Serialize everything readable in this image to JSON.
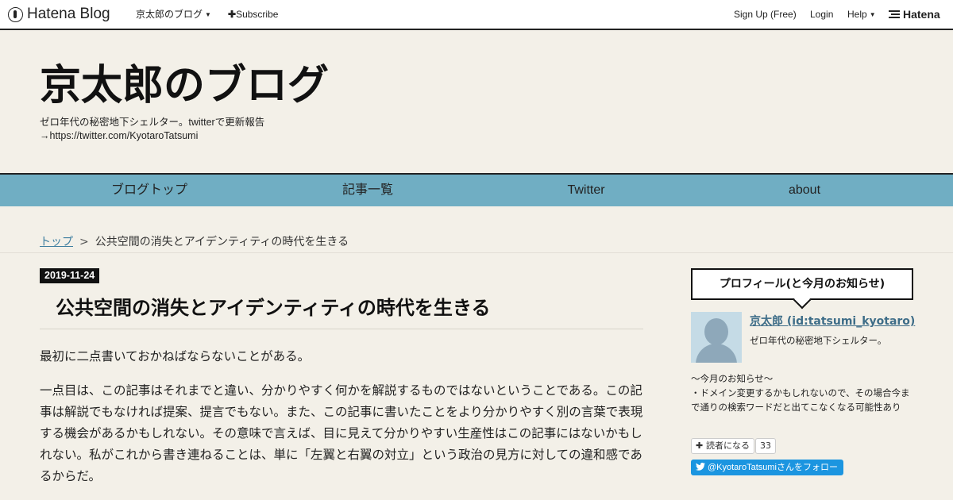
{
  "topbar": {
    "logo": "Hatena Blog",
    "blog_menu": "京太郎のブログ",
    "subscribe": "Subscribe",
    "signup": "Sign Up (Free)",
    "login": "Login",
    "help": "Help",
    "brand": "Hatena"
  },
  "header": {
    "title": "京太郎のブログ",
    "description_line1": "ゼロ年代の秘密地下シェルター。twitterで更新報告",
    "description_line2": "→https://twitter.com/KyotaroTatsumi"
  },
  "nav": {
    "items": [
      {
        "label": "ブログトップ"
      },
      {
        "label": "記事一覧"
      },
      {
        "label": "Twitter"
      },
      {
        "label": "about"
      }
    ]
  },
  "breadcrumb": {
    "home": "トップ",
    "separator": ">",
    "current": "公共空間の消失とアイデンティティの時代を生きる"
  },
  "article": {
    "date": "2019-11-24",
    "title": "公共空間の消失とアイデンティティの時代を生きる",
    "paragraphs": [
      "最初に二点書いておかねばならないことがある。",
      "一点目は、この記事はそれまでと違い、分かりやすく何かを解説するものではないということである。この記事は解説でもなければ提案、提言でもない。また、この記事に書いたことをより分かりやすく別の言葉で表現する機会があるかもしれない。その意味で言えば、目に見えて分かりやすい生産性はこの記事にはないかもしれない。私がこれから書き連ねることは、単に「左翼と右翼の対立」という政治の見方に対しての違和感であるからだ。"
    ]
  },
  "sidebar": {
    "profile_heading": "プロフィール(と今月のお知らせ)",
    "profile_name": "京太郎 (id:tatsumi_kyotaro)",
    "profile_desc": "ゼロ年代の秘密地下シェルター。",
    "notice_title": "～今月のお知らせ～",
    "notice_body": "・ドメイン変更するかもしれないので、その場合今まで通りの検索ワードだと出てこなくなる可能性あり",
    "subscribe_label": "読者になる",
    "subscriber_count": "33",
    "twitter_follow": "@KyotaroTatsumiさんをフォロー"
  },
  "colors": {
    "background": "#f3f0e8",
    "nav": "#70aec3",
    "link": "#3e6d88",
    "twitter": "#1b95e0"
  }
}
